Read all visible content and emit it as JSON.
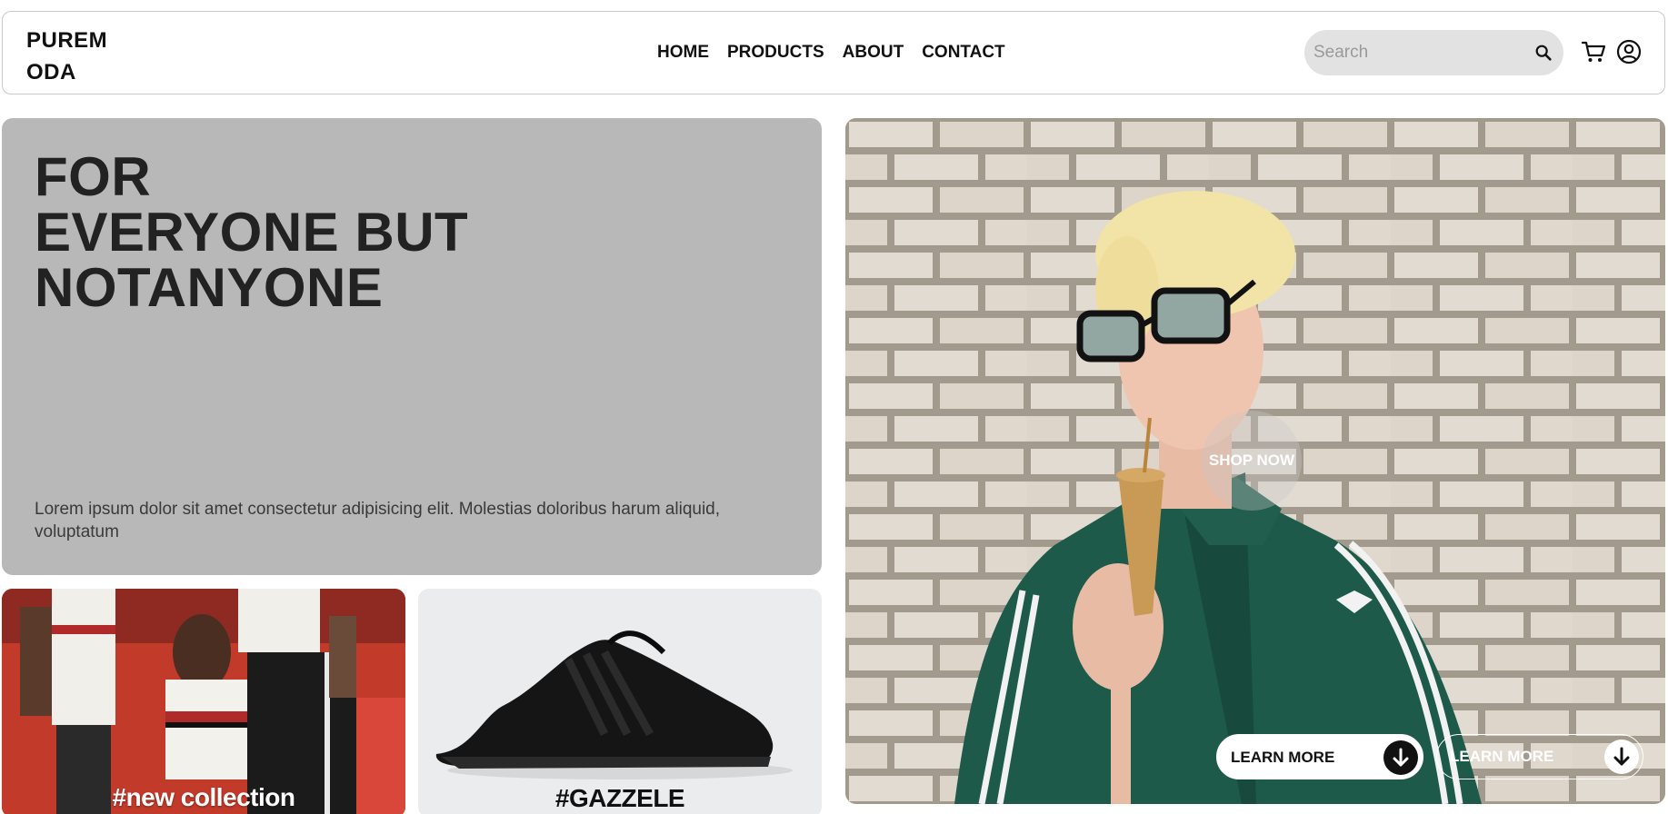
{
  "header": {
    "logo": "PUREM\nODA",
    "nav": [
      "HOME",
      "PRODUCTS",
      "ABOUT",
      "CONTACT"
    ],
    "search_placeholder": "Search"
  },
  "hero": {
    "title": "FOR\nEVERYONE BUT\nNOTANYONE",
    "description": "Lorem ipsum dolor sit amet consectetur adipisicing elit. Molestias doloribus harum aliquid, voluptatum"
  },
  "tiles": {
    "collection_caption": "#new collection",
    "shoe_caption": "#GAZZELE"
  },
  "feature": {
    "shop_now": "SHOP NOW",
    "learn_more_1": "LEARN MORE",
    "learn_more_2": "LEARN MORE"
  },
  "colors": {
    "hero_bg": "#b8b8b8",
    "jacket_green": "#1e5a4a",
    "brick": "#d9cfc2"
  }
}
